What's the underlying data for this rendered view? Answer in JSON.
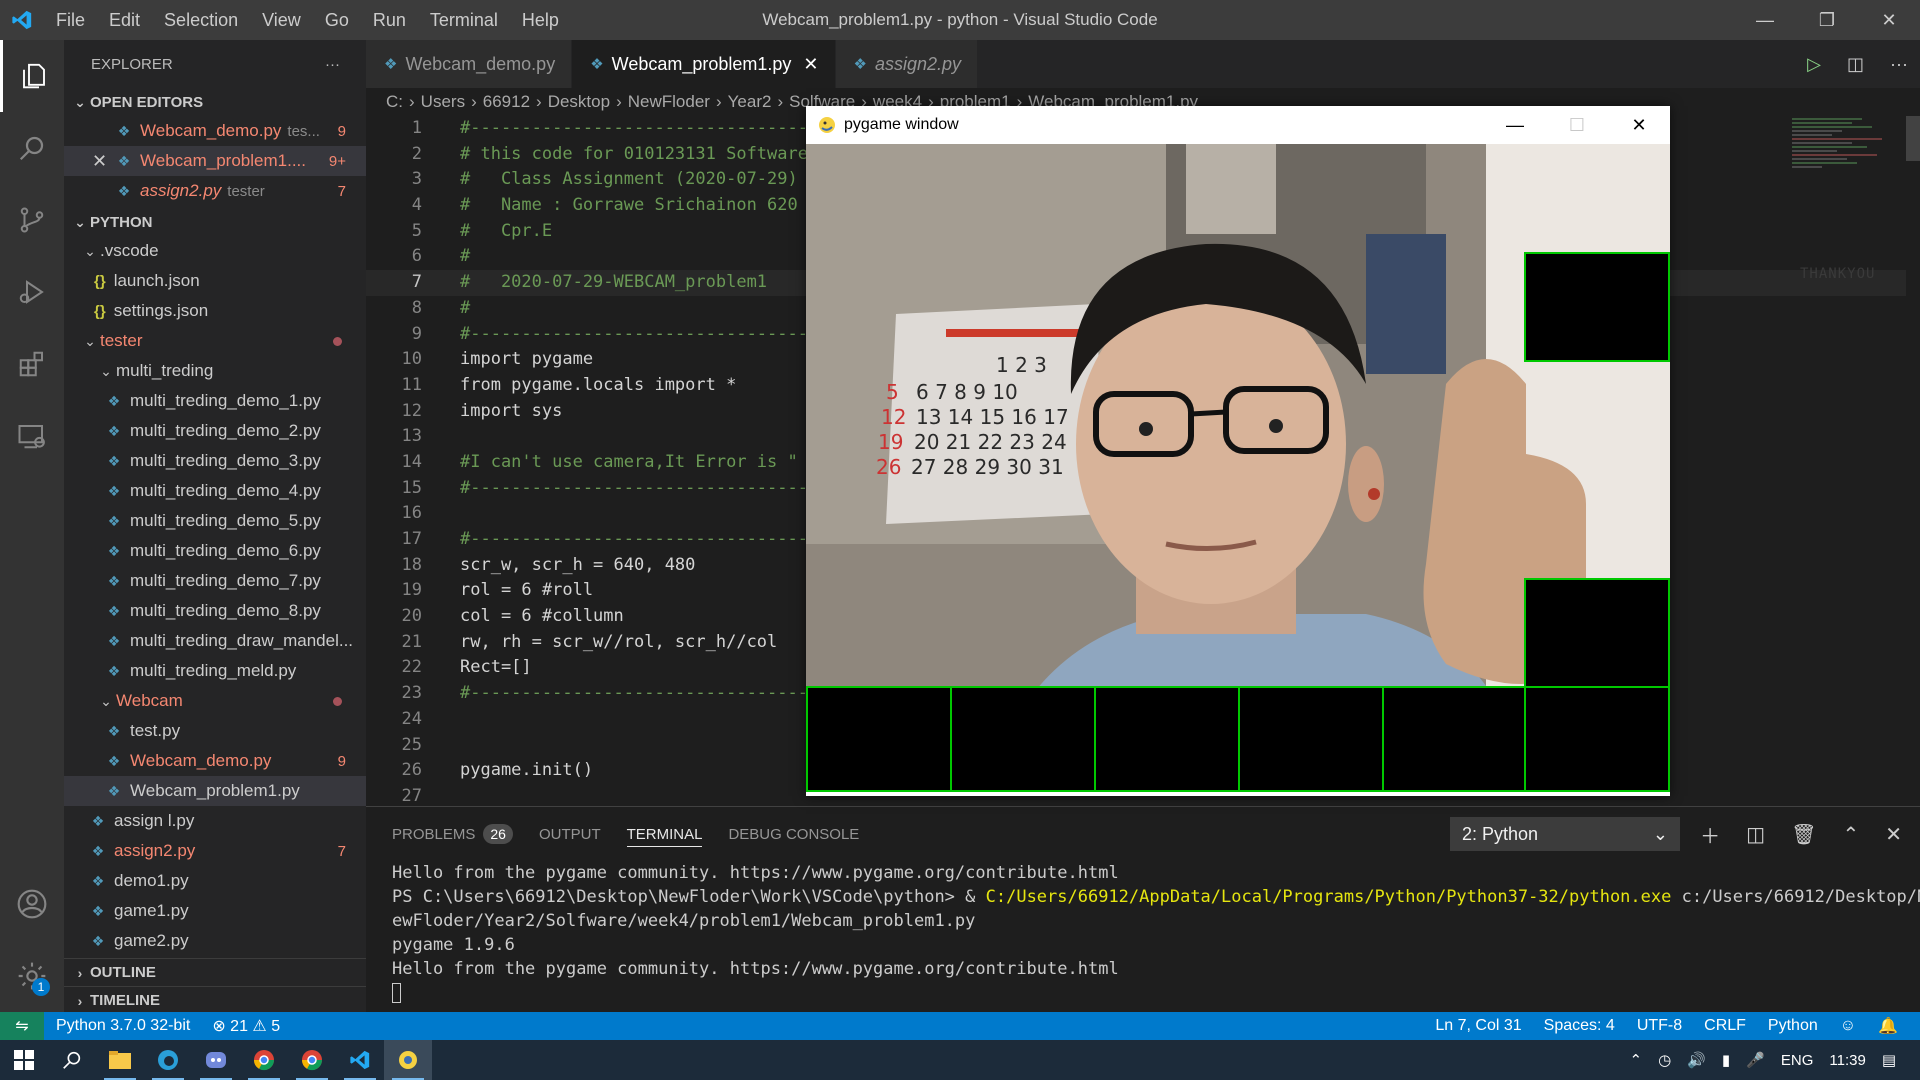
{
  "titlebar": {
    "menu": [
      "File",
      "Edit",
      "Selection",
      "View",
      "Go",
      "Run",
      "Terminal",
      "Help"
    ],
    "title": "Webcam_problem1.py - python - Visual Studio Code"
  },
  "activitybar": {
    "settings_badge": "1"
  },
  "sidebar": {
    "header": "EXPLORER",
    "open_editors": {
      "title": "OPEN EDITORS",
      "items": [
        {
          "name": "Webcam_demo.py",
          "desc": "tes...",
          "count": "9"
        },
        {
          "name": "Webcam_problem1....",
          "count": "9+"
        },
        {
          "name": "assign2.py",
          "desc": "tester",
          "count": "7"
        }
      ]
    },
    "python": {
      "title": "PYTHON",
      "vscode": ".vscode",
      "launch": "launch.json",
      "settings": "settings.json",
      "tester": "tester",
      "multi_treding": "multi_treding",
      "multi_files": [
        "multi_treding_demo_1.py",
        "multi_treding_demo_2.py",
        "multi_treding_demo_3.py",
        "multi_treding_demo_4.py",
        "multi_treding_demo_5.py",
        "multi_treding_demo_6.py",
        "multi_treding_demo_7.py",
        "multi_treding_demo_8.py",
        "multi_treding_draw_mandel...",
        "multi_treding_meld.py"
      ],
      "webcam": "Webcam",
      "test": "test.py",
      "webcam_demo": "Webcam_demo.py",
      "webcam_demo_count": "9",
      "webcam_problem1": "Webcam_problem1.py",
      "assign1": "assign l.py",
      "assign2": "assign2.py",
      "assign2_count": "7",
      "demo1": "demo1.py",
      "game1": "game1.py",
      "game2": "game2.py"
    },
    "outline": "OUTLINE",
    "timeline": "TIMELINE"
  },
  "tabs": [
    {
      "label": "Webcam_demo.py"
    },
    {
      "label": "Webcam_problem1.py"
    },
    {
      "label": "assign2.py"
    }
  ],
  "breadcrumb": [
    "C:",
    "Users",
    "66912",
    "Desktop",
    "NewFloder",
    "Year2",
    "Solfware",
    "week4",
    "problem1",
    "Webcam_problem1.py"
  ],
  "editor": {
    "lines": [
      "#--------------------------------------------------------",
      "# this code for 010123131 Software",
      "#   Class Assignment (2020-07-29)",
      "#   Name : Gorrawe Srichainon 620",
      "#   Cpr.E",
      "#",
      "#   2020-07-29-WEBCAM_problem1",
      "#",
      "#--------------------------------------------------------",
      "import pygame",
      "from pygame.locals import *",
      "import sys",
      "",
      "#I can't use camera,It Error is \"",
      "#--------------------------------------------------------",
      "",
      "#--------------------------------------------------------",
      "scr_w, scr_h = 640, 480",
      "rol = 6 #roll",
      "col = 6 #collumn",
      "rw, rh = scr_w//rol, scr_h//col",
      "Rect=[]",
      "#--------------------------------------------------------",
      "",
      "",
      "pygame.init()",
      ""
    ]
  },
  "minimap": {
    "watermark": "THANKYOU"
  },
  "pygame": {
    "title": "pygame window"
  },
  "panel": {
    "tabs": [
      "PROBLEMS",
      "OUTPUT",
      "TERMINAL",
      "DEBUG CONSOLE"
    ],
    "problems_count": "26",
    "terminal_select": "2: Python",
    "terminal": {
      "line1": "Hello from the pygame community. https://www.pygame.org/contribute.html",
      "line2_prefix": "PS C:\\Users\\66912\\Desktop\\NewFloder\\Work\\VSCode\\python> & ",
      "line2_exe": "C:/Users/66912/AppData/Local/Programs/Python/Python37-32/python.exe",
      "line2_arg": " c:/Users/66912/Desktop/N",
      "line3": "ewFloder/Year2/Solfware/week4/problem1/Webcam_problem1.py",
      "line4": "pygame 1.9.6",
      "line5": "Hello from the pygame community. https://www.pygame.org/contribute.html"
    }
  },
  "statusbar": {
    "interpreter": "Python 3.7.0 32-bit",
    "errors": "21",
    "warnings": "5",
    "position": "Ln 7, Col 31",
    "spaces": "Spaces: 4",
    "encoding": "UTF-8",
    "eol": "CRLF",
    "language": "Python"
  },
  "taskbar": {
    "lang": "ENG",
    "time": "11:39"
  },
  "colors": {
    "accent": "#007acc",
    "error": "#f48771",
    "grid_green": "#00c800"
  }
}
